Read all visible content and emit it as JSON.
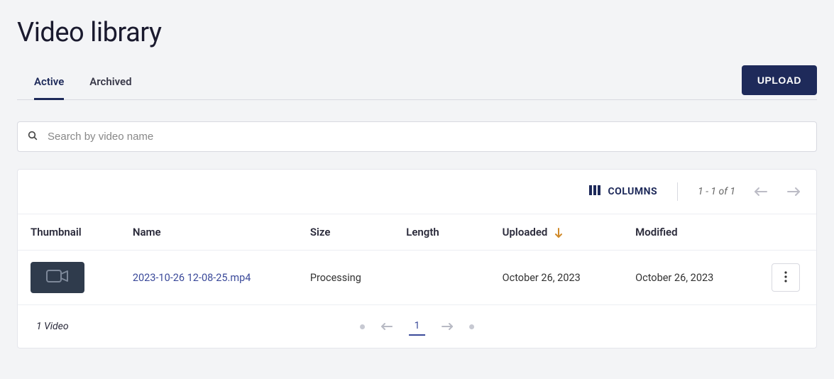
{
  "page": {
    "title": "Video library"
  },
  "tabs": {
    "active": "Active",
    "archived": "Archived"
  },
  "upload": {
    "label": "UPLOAD"
  },
  "search": {
    "placeholder": "Search by video name"
  },
  "toolbar": {
    "columns_label": "COLUMNS",
    "pager_info": "1 - 1 of 1"
  },
  "table": {
    "headers": {
      "thumbnail": "Thumbnail",
      "name": "Name",
      "size": "Size",
      "length": "Length",
      "uploaded": "Uploaded",
      "modified": "Modified"
    },
    "sort": {
      "column": "uploaded",
      "direction": "desc"
    },
    "rows": [
      {
        "name": "2023-10-26 12-08-25.mp4",
        "size": "Processing",
        "length": "",
        "uploaded": "October 26, 2023",
        "modified": "October 26, 2023"
      }
    ]
  },
  "footer": {
    "count_text": "1 Video",
    "current_page": "1"
  }
}
